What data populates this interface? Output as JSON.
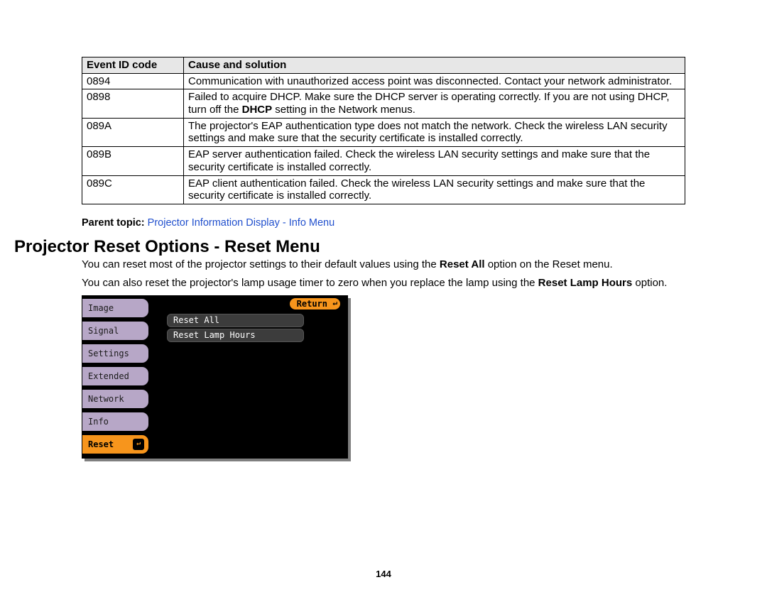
{
  "table": {
    "headers": [
      "Event ID code",
      "Cause and solution"
    ],
    "rows": [
      {
        "code": "0894",
        "cause": "Communication with unauthorized access point was disconnected. Contact your network administrator."
      },
      {
        "code": "0898",
        "cause_pre": "Failed to acquire DHCP. Make sure the DHCP server is operating correctly. If you are not using DHCP, turn off the ",
        "cause_bold": "DHCP",
        "cause_post": " setting in the Network menus."
      },
      {
        "code": "089A",
        "cause": "The projector's EAP authentication type does not match the network. Check the wireless LAN security settings and make sure that the security certificate is installed correctly."
      },
      {
        "code": "089B",
        "cause": "EAP server authentication failed. Check the wireless LAN security settings and make sure that the security certificate is installed correctly."
      },
      {
        "code": "089C",
        "cause": "EAP client authentication failed. Check the wireless LAN security settings and make sure that the security certificate is installed correctly."
      }
    ]
  },
  "parent_topic": {
    "label": "Parent topic:",
    "link": "Projector Information Display - Info Menu"
  },
  "section_title": "Projector Reset Options - Reset Menu",
  "para1": {
    "pre": "You can reset most of the projector settings to their default values using the ",
    "bold": "Reset All",
    "post": " option on the Reset menu."
  },
  "para2": {
    "pre": "You can also reset the projector's lamp usage timer to zero when you replace the lamp using the ",
    "bold": "Reset Lamp Hours",
    "post": " option."
  },
  "osd": {
    "tabs": [
      "Image",
      "Signal",
      "Settings",
      "Extended",
      "Network",
      "Info",
      "Reset"
    ],
    "active_tab": "Reset",
    "return": "Return",
    "items": [
      "Reset All",
      "Reset Lamp Hours"
    ]
  },
  "page_number": "144"
}
